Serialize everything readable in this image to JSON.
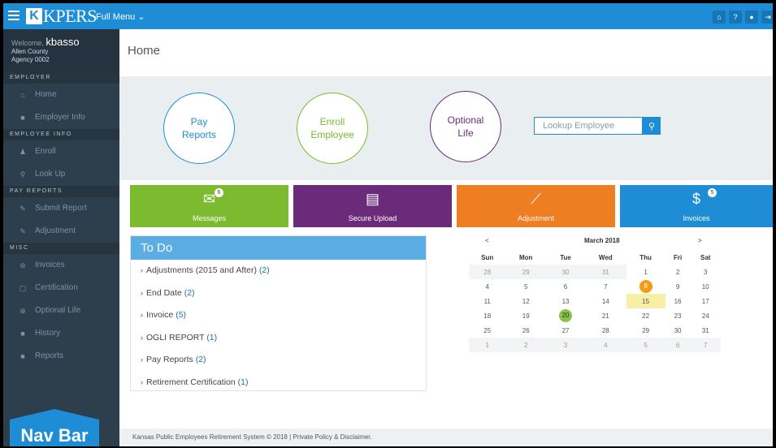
{
  "topbar": {
    "logo_letter": "K",
    "logo_text": "KPERS",
    "full_menu": "Full Menu ⌄",
    "icons": [
      "home-icon",
      "help-icon",
      "user-icon",
      "logout-icon"
    ]
  },
  "sidebar": {
    "welcome_prefix": "Welcome,",
    "username": "kbasso",
    "county": "Allen County",
    "agency": "Agency 0002",
    "sections": [
      {
        "header": "EMPLOYER",
        "items": [
          {
            "label": "Home",
            "icon": "home-icon"
          },
          {
            "label": "Employer Info",
            "icon": "briefcase-icon"
          }
        ]
      },
      {
        "header": "EMPLOYEE INFO",
        "items": [
          {
            "label": "Enroll",
            "icon": "add-user-icon"
          },
          {
            "label": "Look Up",
            "icon": "search-icon"
          }
        ]
      },
      {
        "header": "PAY REPORTS",
        "items": [
          {
            "label": "Submit Report",
            "icon": "pencil-icon"
          },
          {
            "label": "Adjustment",
            "icon": "pencil-icon"
          }
        ]
      },
      {
        "header": "MISC",
        "items": [
          {
            "label": "Invoices",
            "icon": "invoice-icon"
          },
          {
            "label": "Certification",
            "icon": "document-icon"
          },
          {
            "label": "Optional Life",
            "icon": "life-ring-icon"
          },
          {
            "label": "History",
            "icon": "history-icon"
          },
          {
            "label": "Reports",
            "icon": "reports-icon"
          }
        ]
      }
    ],
    "navbar_badge": "Nav Bar"
  },
  "main": {
    "title": "Home",
    "circles": {
      "pay_reports": "Pay\nReports",
      "enroll": "Enroll\nEmployee",
      "optional_life": "Optional\nLife"
    },
    "lookup_placeholder": "Lookup Employee",
    "tiles": [
      {
        "label": "Messages",
        "badge": "6",
        "color": "#7cba2f",
        "icon": "envelope-icon"
      },
      {
        "label": "Secure Upload",
        "badge": "",
        "color": "#6b2b7a",
        "icon": "document-icon"
      },
      {
        "label": "Adjustment",
        "badge": "",
        "color": "#ef7d22",
        "icon": "chart-line-icon"
      },
      {
        "label": "Invoices",
        "badge": "5",
        "color": "#1f8dd6",
        "icon": "money-icon"
      }
    ],
    "todo": {
      "title": "To Do",
      "items": [
        {
          "label": "Adjustments (2015 and After)",
          "count": "(2)"
        },
        {
          "label": "End Date",
          "count": "(2)"
        },
        {
          "label": "Invoice",
          "count": "(5)"
        },
        {
          "label": "OGLI REPORT",
          "count": "(1)"
        },
        {
          "label": "Pay Reports",
          "count": "(2)"
        },
        {
          "label": "Retirement Certification",
          "count": "(1)"
        }
      ]
    },
    "calendar": {
      "prev": "<",
      "next": ">",
      "title": "March 2018",
      "weekdays": [
        "Sun",
        "Mon",
        "Tue",
        "Wed",
        "Thu",
        "Fri",
        "Sat"
      ],
      "weeks": [
        [
          "28",
          "29",
          "30",
          "31",
          "1",
          "2",
          "3"
        ],
        [
          "4",
          "5",
          "6",
          "7",
          "8",
          "9",
          "10"
        ],
        [
          "11",
          "12",
          "13",
          "14",
          "15",
          "16",
          "17"
        ],
        [
          "18",
          "19",
          "20",
          "21",
          "22",
          "23",
          "24"
        ],
        [
          "25",
          "26",
          "27",
          "28",
          "29",
          "30",
          "31"
        ],
        [
          "1",
          "2",
          "3",
          "4",
          "5",
          "6",
          "7"
        ]
      ]
    },
    "footer": "Kansas Public Employees Retirement System © 2018 | Private Policy & Disclaimer."
  }
}
